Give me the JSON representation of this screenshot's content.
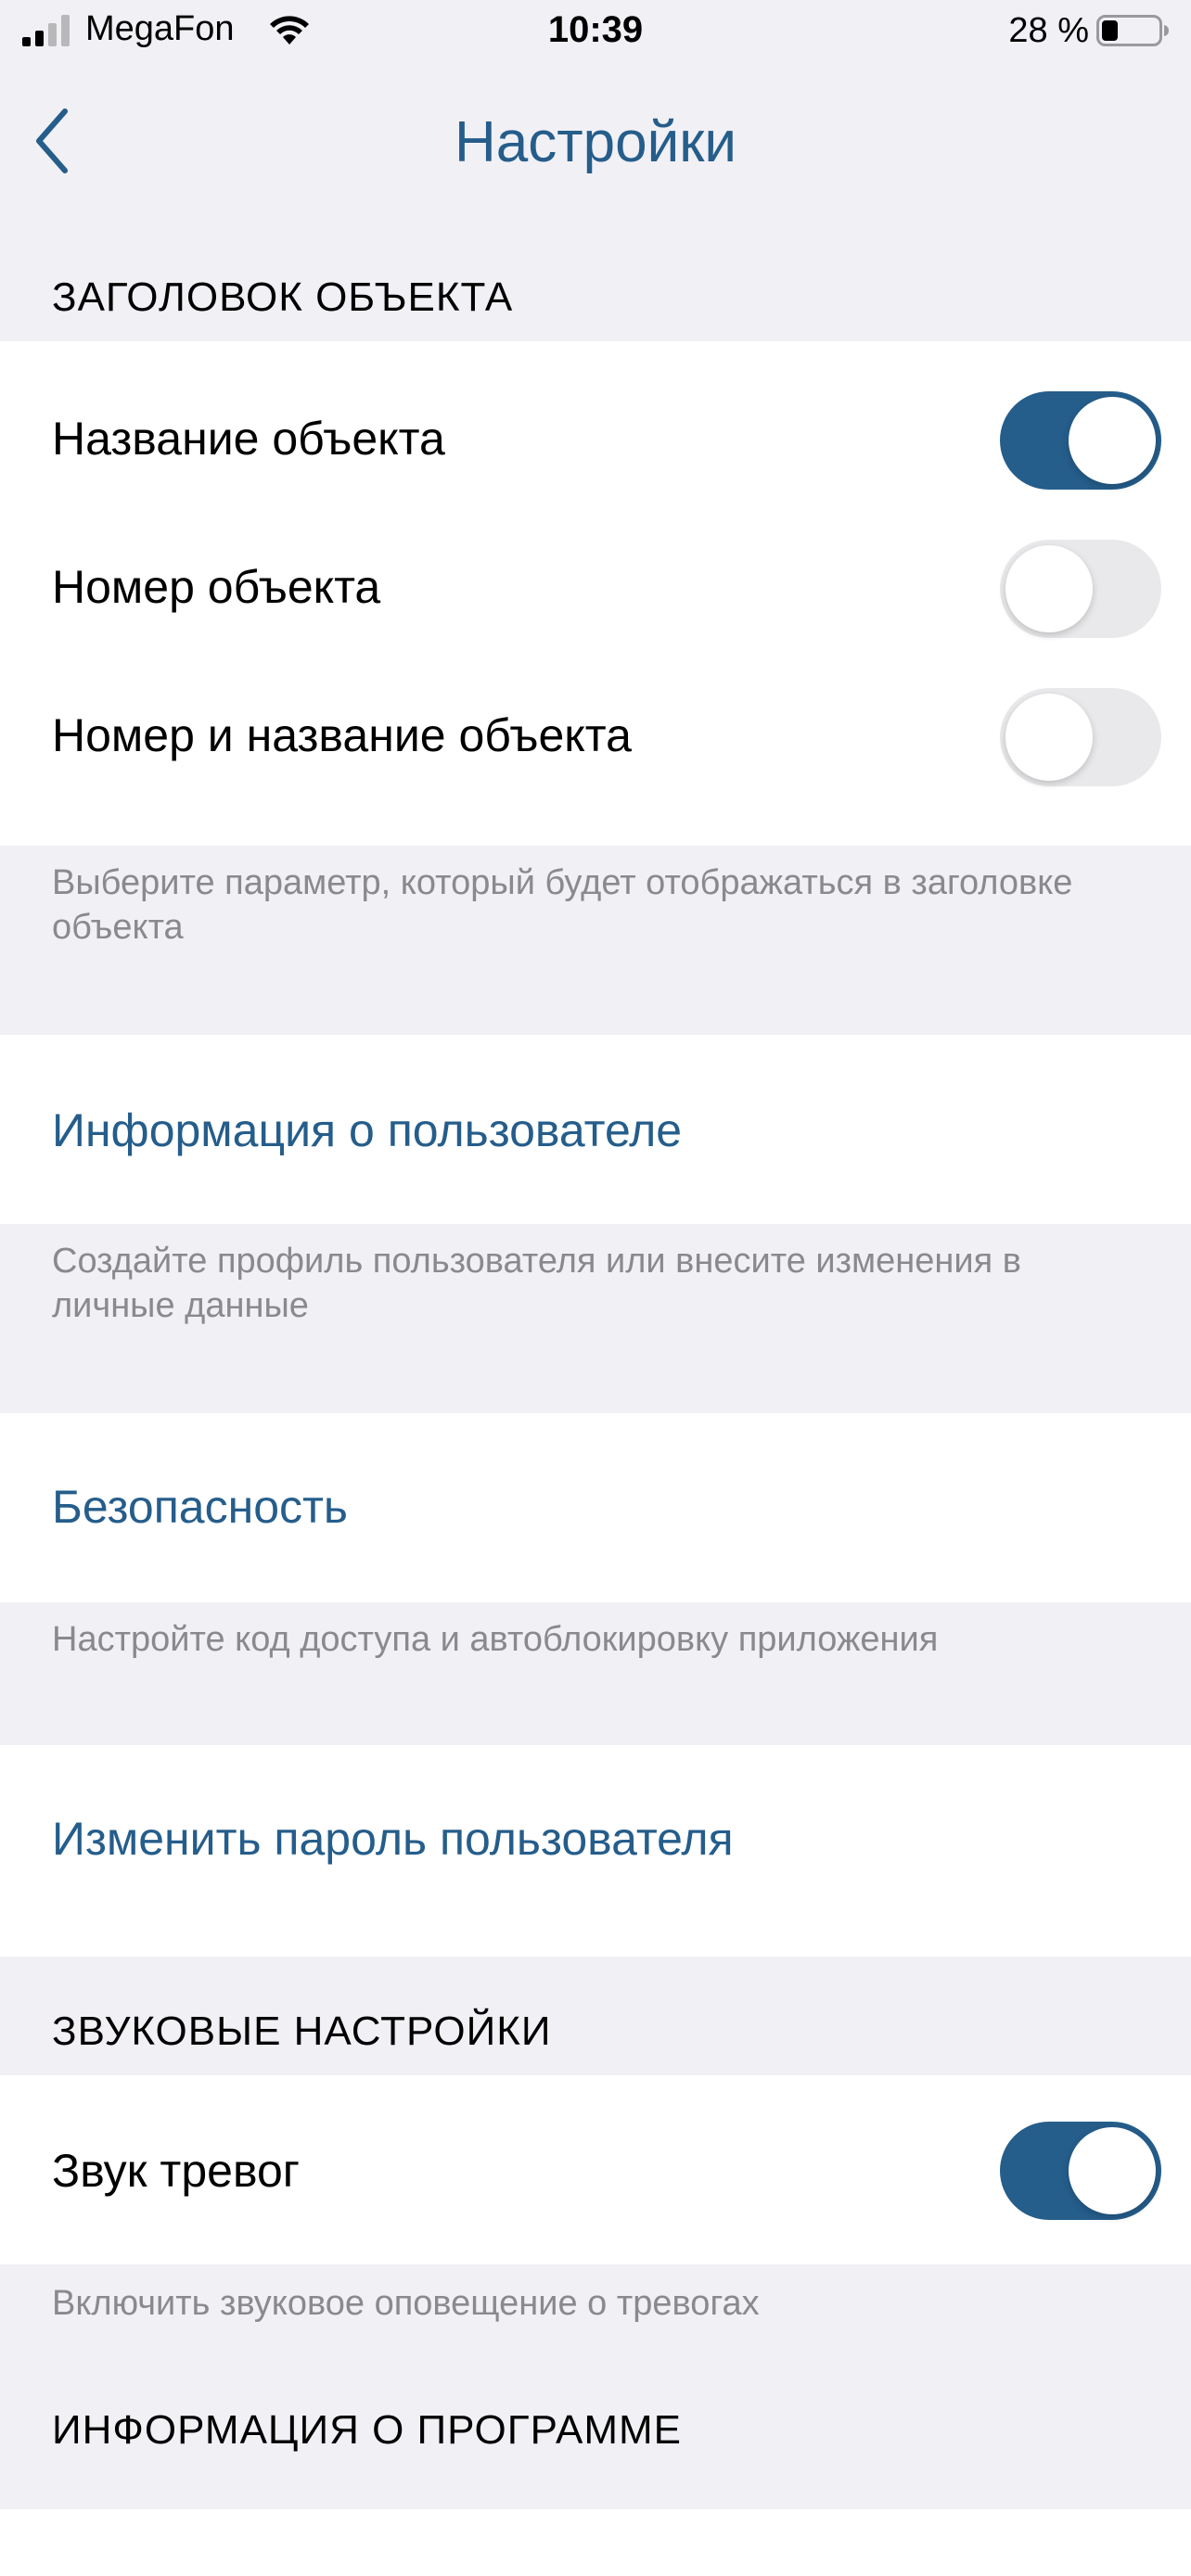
{
  "status_bar": {
    "carrier": "MegaFon",
    "time": "10:39",
    "battery_percent": "28 %",
    "battery_level": 0.28
  },
  "nav": {
    "title": "Настройки",
    "back_icon": "chevron-left-icon"
  },
  "object_header_section": {
    "header": "ЗАГОЛОВОК ОБЪЕКТА",
    "items": [
      {
        "label": "Название объекта",
        "enabled": true
      },
      {
        "label": "Номер объекта",
        "enabled": false
      },
      {
        "label": "Номер и название объекта",
        "enabled": false
      }
    ],
    "footer": "Выберите параметр, который будет отображаться в заголовке объекта"
  },
  "user_info": {
    "label": "Информация о пользователе",
    "footer": "Создайте профиль пользователя или внесите изменения в личные данные"
  },
  "security": {
    "label": "Безопасность",
    "footer": "Настройте код доступа и автоблокировку приложения"
  },
  "change_password": {
    "label": "Изменить пароль пользователя"
  },
  "sound_section": {
    "header": "ЗВУКОВЫЕ НАСТРОЙКИ",
    "item": {
      "label": "Звук тревог",
      "enabled": true
    },
    "footer": "Включить звуковое оповещение о тревогах"
  },
  "about_section": {
    "header": "ИНФОРМАЦИЯ О ПРОГРАММЕ"
  },
  "colors": {
    "accent": "#255d8b",
    "background": "#f1f0f5",
    "footer_text": "#8a8a8e",
    "toggle_off": "#e9e9eb"
  }
}
